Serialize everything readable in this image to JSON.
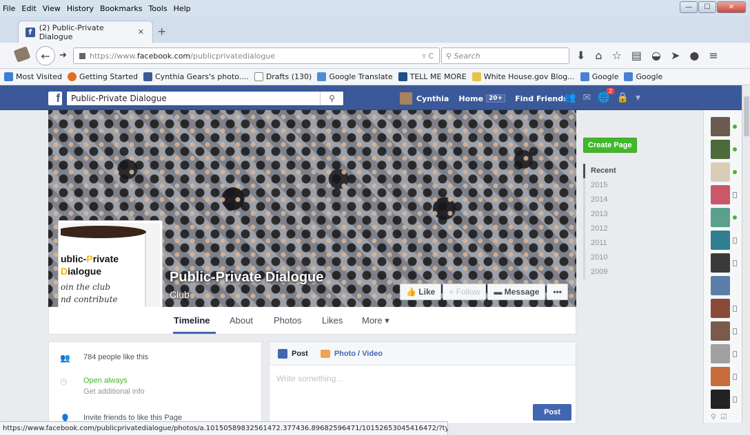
{
  "browser": {
    "menu": [
      "File",
      "Edit",
      "View",
      "History",
      "Bookmarks",
      "Tools",
      "Help"
    ],
    "tab_title": "(2) Public-Private Dialogue",
    "url_prefix": "https://www.",
    "url_domain": "facebook.com",
    "url_path": "/publicprivatedialogue",
    "search_placeholder": "Search",
    "bookmarks": [
      {
        "label": "Most Visited",
        "color": "#3b7fd6"
      },
      {
        "label": "Getting Started",
        "color": "#e07020"
      },
      {
        "label": "Cynthia Gears's photo....",
        "color": "#3b5998"
      },
      {
        "label": "Drafts (130)",
        "color": "#ffffff"
      },
      {
        "label": "Google Translate",
        "color": "#4a8ed6"
      },
      {
        "label": "TELL ME MORE",
        "color": "#1d4f8a"
      },
      {
        "label": "White House.gov Blog...",
        "color": "#e8c34a"
      },
      {
        "label": "Google",
        "color": "#4a7fd6"
      },
      {
        "label": "Google",
        "color": "#4a7fd6"
      }
    ],
    "status_url": "https://www.facebook.com/publicprivatedialogue/photos/a.10150589832561472.377436.89682596471/10152653045416472/?type=1"
  },
  "fb": {
    "search_value": "Public-Private Dialogue",
    "user_name": "Cynthia",
    "home_label": "Home",
    "home_count": "20+",
    "find_friends": "Find Friends",
    "notif_count": "2"
  },
  "page": {
    "title": "Public-Private Dialogue",
    "category": "Club",
    "mug_line1_a": "ublic-",
    "mug_line1_b": "P",
    "mug_line1_c": "rivate",
    "mug_line2_a": "D",
    "mug_line2_b": "ialogue",
    "mug_line3": "oin the club",
    "mug_line4": "nd contribute",
    "buttons": {
      "like": "Like",
      "follow": "Follow",
      "message": "Message",
      "more": "•••"
    },
    "tabs": [
      "Timeline",
      "About",
      "Photos",
      "Likes",
      "More ▾"
    ],
    "likes_text": "784 people like this",
    "open_text": "Open always",
    "info_text": "Get additional info",
    "invite_text": "Invite friends to like this Page"
  },
  "composer": {
    "post_tab": "Post",
    "photo_tab": "Photo / Video",
    "placeholder": "Write something...",
    "post_button": "Post"
  },
  "sidebar": {
    "create_page": "Create Page",
    "years": [
      "Recent",
      "2015",
      "2014",
      "2013",
      "2012",
      "2011",
      "2010",
      "2009"
    ]
  },
  "chat": {
    "contacts": [
      {
        "color": "#6b5a4e",
        "status": "online"
      },
      {
        "color": "#4d6a3a",
        "status": "online"
      },
      {
        "color": "#d9cdb8",
        "status": "online"
      },
      {
        "color": "#c9586a",
        "status": "mobile"
      },
      {
        "color": "#5aa08a",
        "status": "online"
      },
      {
        "color": "#2f7f8f",
        "status": "mobile"
      },
      {
        "color": "#3a3a3a",
        "status": "mobile"
      },
      {
        "color": "#5a7ea8",
        "status": "none"
      },
      {
        "color": "#8a4a3a",
        "status": "mobile"
      },
      {
        "color": "#7a5a4a",
        "status": "mobile"
      },
      {
        "color": "#a0a0a0",
        "status": "mobile"
      },
      {
        "color": "#c86a3a",
        "status": "mobile"
      },
      {
        "color": "#222222",
        "status": "mobile"
      }
    ]
  }
}
